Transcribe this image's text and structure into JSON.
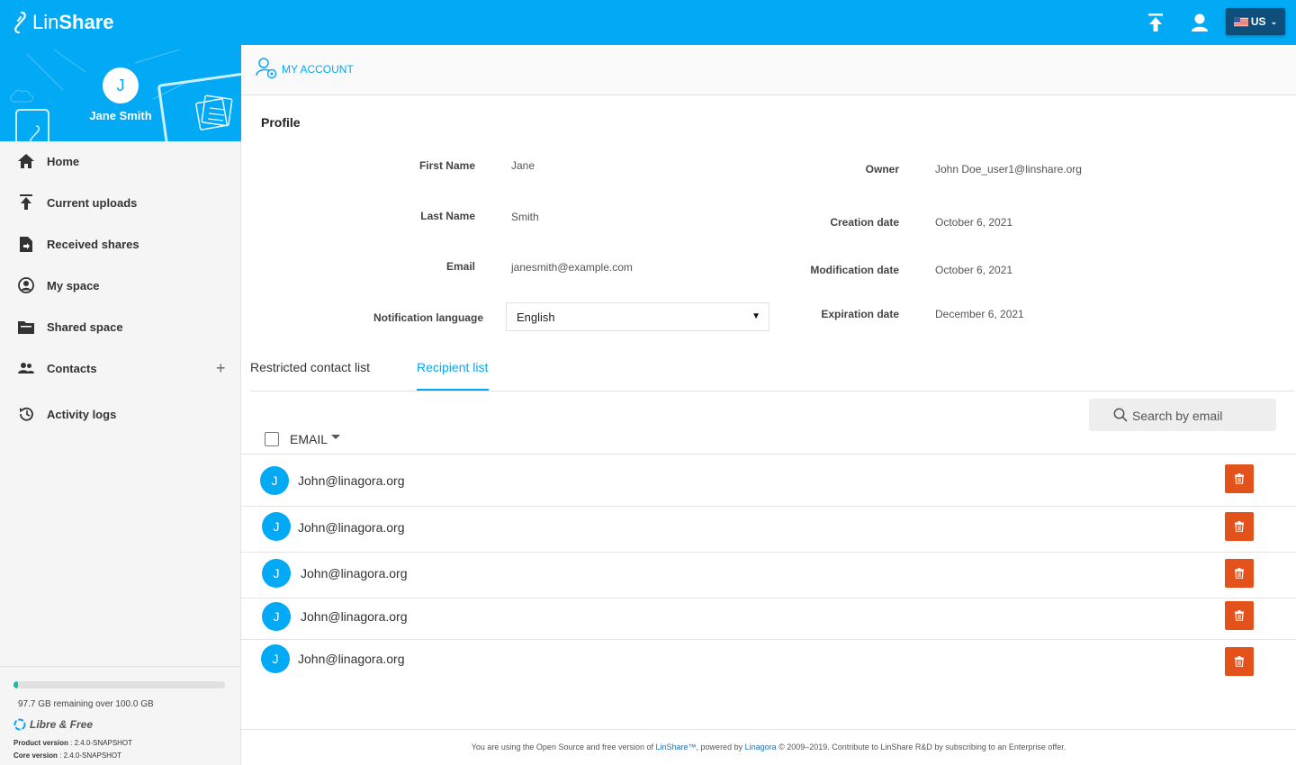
{
  "app": {
    "logo_part1": "Lin",
    "logo_part2": "Share",
    "language": "US",
    "brand_color": "#02a9f4"
  },
  "user": {
    "initial": "J",
    "name": "Jane Smith"
  },
  "sidebar": {
    "items": [
      {
        "label": "Home",
        "icon": "home-icon"
      },
      {
        "label": "Current uploads",
        "icon": "upload-icon"
      },
      {
        "label": "Received shares",
        "icon": "received-shares-icon"
      },
      {
        "label": "My space",
        "icon": "my-space-icon"
      },
      {
        "label": "Shared space",
        "icon": "shared-space-icon"
      },
      {
        "label": "Contacts",
        "icon": "contacts-icon",
        "action": "+"
      },
      {
        "label": "Activity logs",
        "icon": "history-icon"
      }
    ],
    "quota": {
      "text": "97.7 GB remaining over 100.0 GB",
      "used_fraction": 0.023
    },
    "libre_free": "Libre & Free",
    "product_version_label": "Product version",
    "product_version": " : 2.4.0-SNAPSHOT",
    "core_version_label": "Core version",
    "core_version": " : 2.4.0-SNAPSHOT"
  },
  "page": {
    "title": "MY ACCOUNT",
    "section_title": "Profile"
  },
  "profile": {
    "first_name_label": "First Name",
    "first_name": "Jane",
    "last_name_label": "Last Name",
    "last_name": "Smith",
    "email_label": "Email",
    "email": "janesmith@example.com",
    "notification_language_label": "Notification language",
    "notification_language": "English",
    "owner_label": "Owner",
    "owner": "John Doe_user1@linshare.org",
    "creation_date_label": "Creation date",
    "creation_date": "October 6, 2021",
    "modification_date_label": "Modification date",
    "modification_date": "October 6, 2021",
    "expiration_date_label": "Expiration date",
    "expiration_date": "December 6, 2021"
  },
  "tabs": [
    {
      "label": "Restricted contact list",
      "active": false
    },
    {
      "label": "Recipient list",
      "active": true
    }
  ],
  "search": {
    "placeholder": "Search by email"
  },
  "list": {
    "column_header": "EMAIL",
    "rows": [
      {
        "initial": "J",
        "email": "John@linagora.org"
      },
      {
        "initial": "J",
        "email": "John@linagora.org"
      },
      {
        "initial": "J",
        "email": "John@linagora.org"
      },
      {
        "initial": "J",
        "email": "John@linagora.org"
      },
      {
        "initial": "J",
        "email": "John@linagora.org"
      }
    ],
    "delete_color": "#e4521b"
  },
  "footer": {
    "text_1": "You are using the Open Source and free version of ",
    "link_linshare": "LinShare™",
    "text_2": ", powered by ",
    "link_linagora": "Linagora",
    "text_3": " © 2009–2019. Contribute to LinShare R&D by subscribing to an Enterprise offer."
  }
}
